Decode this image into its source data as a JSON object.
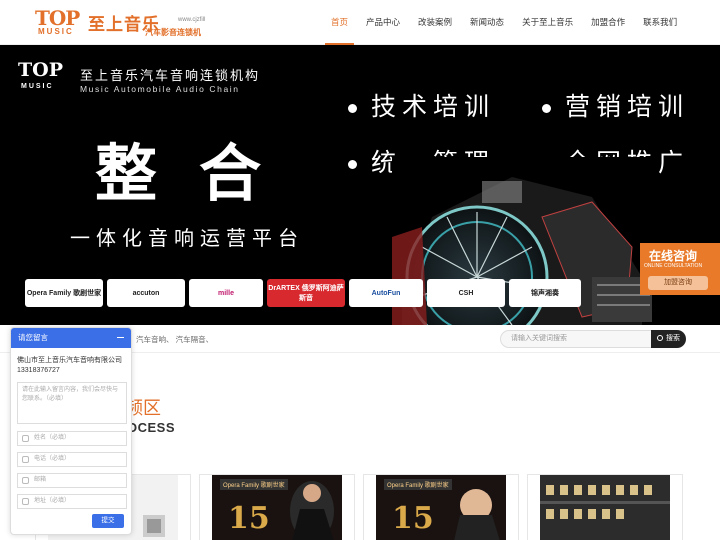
{
  "header": {
    "logo_top": "TOP",
    "logo_music": "MUSIC",
    "logo_cn": "至上音乐",
    "logo_url": "www.cjzfill",
    "logo_sub": "汽车影音连锁机",
    "nav": [
      "首页",
      "产品中心",
      "改装案例",
      "新闻动态",
      "关于至上音乐",
      "加盟合作",
      "联系我们"
    ],
    "active_index": 0
  },
  "banner": {
    "logo_top": "TOP",
    "logo_music": "MUSIC",
    "chain_cn": "至上音乐汽车音响连锁机构",
    "chain_en": "Music Automobile Audio Chain",
    "bullets": [
      "技术培训",
      "营销培训",
      "统一管理",
      "全网推广"
    ],
    "main": "整合",
    "slogan": "一体化音响运营平台",
    "brands": [
      "Opera Family 歌剧世家",
      "accuton",
      "mille",
      "DrARTEX 俄罗斯阿迪萨斯音",
      "AutoFun",
      "CSH",
      "锦声湘奏"
    ]
  },
  "online": {
    "title": "在线咨询",
    "subtitle": "ONLINE CONSULTATION",
    "button": "加盟咨询"
  },
  "search": {
    "hot_words": "汽车音响、 汽车隔音、",
    "placeholder": "请输入关键词搜索",
    "button": "搜索"
  },
  "section": {
    "title_cn": "频区",
    "title_en": "OCESS"
  },
  "cards": [
    {
      "label": "",
      "badge": ""
    },
    {
      "label": "Opera Family 歌剧世家",
      "badge": "15"
    },
    {
      "label": "Opera Family 歌剧世家",
      "badge": "15"
    },
    {
      "label": "",
      "badge": ""
    }
  ],
  "chat": {
    "title": "请您留言",
    "company": "佛山市至上音乐汽车音响有限公司",
    "phone": "13318376727",
    "message_placeholder": "请在此输入留言内容，我们会尽快与您联系。（必填）",
    "name_placeholder": "姓名（必填）",
    "tel_placeholder": "电话（必填）",
    "email_placeholder": "邮箱",
    "address_placeholder": "地址（必填）",
    "submit": "提交"
  },
  "colors": {
    "accent": "#e2702a",
    "chat_blue": "#3a6fe8",
    "banner_bg": "#000000"
  }
}
